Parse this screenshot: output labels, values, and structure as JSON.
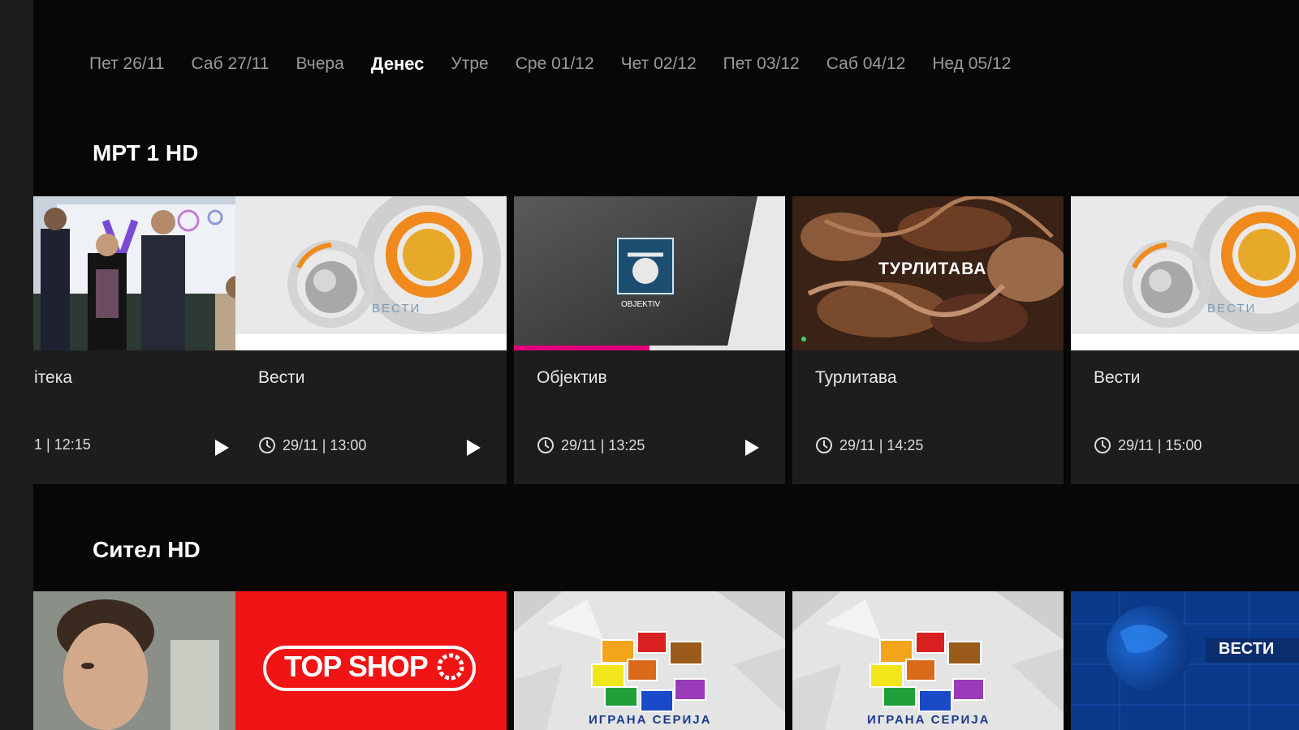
{
  "dates": [
    {
      "label": "Пет 26/11",
      "active": false
    },
    {
      "label": "Саб 27/11",
      "active": false
    },
    {
      "label": "Вчера",
      "active": false
    },
    {
      "label": "Денес",
      "active": true
    },
    {
      "label": "Утре",
      "active": false
    },
    {
      "label": "Сре 01/12",
      "active": false
    },
    {
      "label": "Чет 02/12",
      "active": false
    },
    {
      "label": "Пет 03/12",
      "active": false
    },
    {
      "label": "Саб 04/12",
      "active": false
    },
    {
      "label": "Нед 05/12",
      "active": false
    }
  ],
  "channels": [
    {
      "name": "МРТ 1 HD",
      "programs": [
        {
          "title": "ітека",
          "time": "1  |  12:15",
          "playable": true
        },
        {
          "title": "Вести",
          "time": "29/11  |  13:00",
          "playable": true,
          "thumb_label": "ВЕСТИ"
        },
        {
          "title": "Објектив",
          "time": "29/11  |  13:25",
          "playable": true,
          "thumb_label": "OBJEKTIV",
          "progress": 0.5
        },
        {
          "title": "Турлитава",
          "time": "29/11  |  14:25",
          "playable": false,
          "thumb_label": "ТУРЛИТАВА"
        },
        {
          "title": "Вести",
          "time": "29/11  |  15:00",
          "playable": false,
          "thumb_label": "ВЕСТИ"
        }
      ]
    },
    {
      "name": "Сител HD",
      "programs": [
        {
          "title": ""
        },
        {
          "title": "",
          "thumb_label": "TOP SHOP"
        },
        {
          "title": "",
          "thumb_label": "ИГРАНА СЕРИЈА"
        },
        {
          "title": "",
          "thumb_label": "ИГРАНА СЕРИЈА"
        },
        {
          "title": "",
          "thumb_label": "ВЕСТИ"
        }
      ]
    }
  ],
  "colors": {
    "progress": "#e2007a",
    "topshop_red": "#f01414"
  }
}
